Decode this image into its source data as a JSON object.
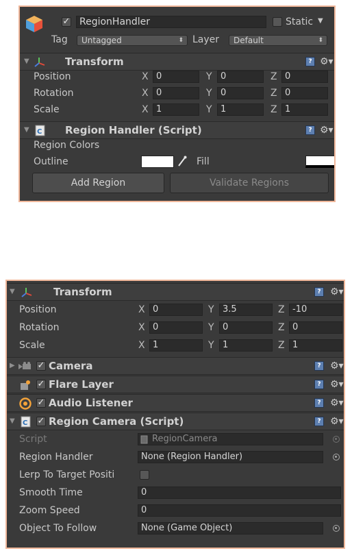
{
  "top": {
    "object_name": "RegionHandler",
    "active": true,
    "static_label": "Static",
    "static_checked": false,
    "tag_label": "Tag",
    "tag_value": "Untagged",
    "layer_label": "Layer",
    "layer_value": "Default",
    "transform": {
      "title": "Transform",
      "rows": [
        {
          "label": "Position",
          "x": "0",
          "y": "0",
          "z": "0"
        },
        {
          "label": "Rotation",
          "x": "0",
          "y": "0",
          "z": "0"
        },
        {
          "label": "Scale",
          "x": "1",
          "y": "1",
          "z": "1"
        }
      ]
    },
    "region_handler": {
      "title": "Region Handler (Script)",
      "colors_label": "Region Colors",
      "outline_label": "Outline",
      "fill_label": "Fill",
      "outline_color": "#ffffff",
      "fill_color": "#ffffff",
      "add_button": "Add Region",
      "validate_button": "Validate Regions"
    }
  },
  "bottom": {
    "transform": {
      "title": "Transform",
      "rows": [
        {
          "label": "Position",
          "x": "0",
          "y": "3.5",
          "z": "-10"
        },
        {
          "label": "Rotation",
          "x": "0",
          "y": "0",
          "z": "0"
        },
        {
          "label": "Scale",
          "x": "1",
          "y": "1",
          "z": "1"
        }
      ]
    },
    "camera_title": "Camera",
    "flare_title": "Flare Layer",
    "audio_title": "Audio Listener",
    "region_camera": {
      "title": "Region Camera (Script)",
      "fields": [
        {
          "label": "Script",
          "value": "RegionCamera"
        },
        {
          "label": "Region Handler",
          "value": "None (Region Handler)"
        },
        {
          "label": "Lerp To Target Positi",
          "value": ""
        },
        {
          "label": "Smooth Time",
          "value": "0"
        },
        {
          "label": "Zoom Speed",
          "value": "0"
        },
        {
          "label": "Object To Follow",
          "value": "None (Game Object)"
        }
      ]
    }
  },
  "axes": {
    "x": "X",
    "y": "Y",
    "z": "Z"
  },
  "colors": {
    "accent_border": "#f0b79a",
    "panel_bg": "#3a3a3a",
    "help_icon": "#5d7fb0"
  }
}
